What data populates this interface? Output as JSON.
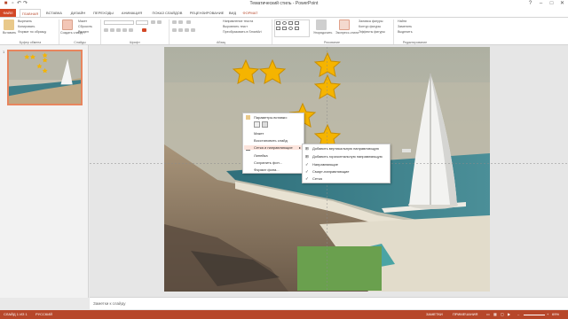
{
  "window": {
    "title": "Тематический стиль - PowerPoint",
    "controls": [
      "?",
      "–",
      "□",
      "✕"
    ]
  },
  "tabs": [
    "ФАЙЛ",
    "ГЛАВНАЯ",
    "ВСТАВКА",
    "ДИЗАЙН",
    "ПЕРЕХОДЫ",
    "АНИМАЦИЯ",
    "ПОКАЗ СЛАЙДОВ",
    "РЕЦЕНЗИРОВАНИЕ",
    "ВИД",
    "ФОРМАТ"
  ],
  "ribbon": {
    "clipboard": {
      "paste": "Вставить",
      "cut": "Вырезать",
      "copy": "Копировать",
      "format": "Формат по образцу",
      "label": "Буфер обмена"
    },
    "slides": {
      "new": "Создать слайд",
      "layout": "Макет",
      "reset": "Сбросить",
      "section": "Раздел",
      "label": "Слайды"
    },
    "font": {
      "label": "Шрифт"
    },
    "paragraph": {
      "dir": "Направление текста",
      "align": "Выровнять текст",
      "smart": "Преобразовать в SmartArt",
      "label": "Абзац"
    },
    "drawing": {
      "arrange": "Упорядочить",
      "styles": "Экспресс-стили",
      "fill": "Заливка фигуры",
      "outline": "Контур фигуры",
      "effects": "Эффекты фигуры",
      "label": "Рисование"
    },
    "editing": {
      "find": "Найти",
      "replace": "Заменить",
      "select": "Выделить",
      "label": "Редактирование"
    }
  },
  "slidepane": {
    "number": "1"
  },
  "context_menu": {
    "paste_params": "Параметры вставки:",
    "items": [
      "Макет",
      "Восстановить слайд",
      "Сетка и направляющие",
      "Линейка",
      "Сохранить фон...",
      "Формат фона..."
    ]
  },
  "submenu": {
    "items": [
      "Добавить вертикальную направляющую",
      "Добавить горизонтальную направляющую",
      "Направляющие",
      "Смарт-направляющие",
      "Сетка"
    ],
    "checked": [
      false,
      false,
      true,
      true,
      true
    ]
  },
  "notes": {
    "placeholder": "Заметки к слайду"
  },
  "statusbar": {
    "slide": "СЛАЙД 1 ИЗ 1",
    "lang": "РУССКИЙ",
    "notes": "ЗАМЕТКИ",
    "comments": "ПРИМЕЧАНИЯ",
    "zoom": "69%"
  },
  "colors": {
    "accent": "#d24726",
    "star": "#f5b400",
    "star_edge": "#c98f00"
  },
  "icons": [
    "paste-icon",
    "star-icon",
    "check-icon",
    "submenu-arrow-icon",
    "grid-icon",
    "ruler-icon"
  ]
}
